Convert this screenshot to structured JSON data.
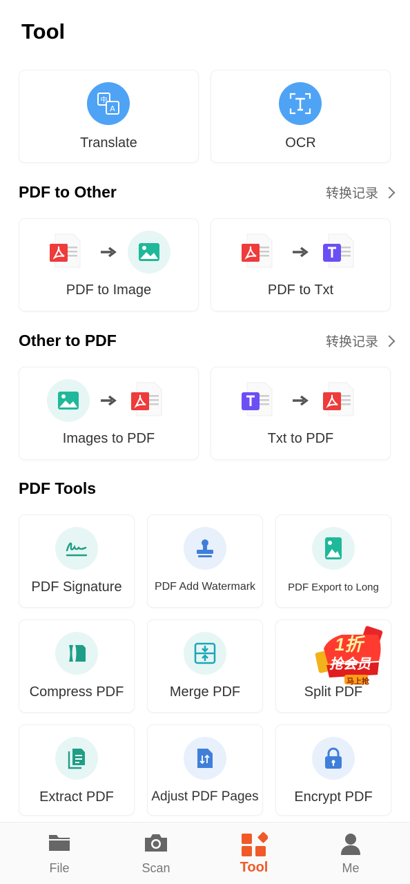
{
  "page": {
    "title": "Tool"
  },
  "top_tools": [
    {
      "label": "Translate",
      "icon": "translate-icon"
    },
    {
      "label": "OCR",
      "icon": "ocr-icon"
    }
  ],
  "pdf_to_other": {
    "title": "PDF to Other",
    "history": "转换记录",
    "items": [
      {
        "label": "PDF to Image"
      },
      {
        "label": "PDF to Txt"
      }
    ]
  },
  "other_to_pdf": {
    "title": "Other to PDF",
    "history": "转换记录",
    "items": [
      {
        "label": "Images to PDF"
      },
      {
        "label": "Txt to PDF"
      }
    ]
  },
  "pdf_tools": {
    "title": "PDF Tools",
    "items": [
      {
        "label": "PDF Signature",
        "icon": "signature-icon"
      },
      {
        "label": "PDF Add Watermark",
        "icon": "stamp-icon"
      },
      {
        "label": "PDF Export to Long",
        "icon": "long-image-icon"
      },
      {
        "label": "Compress PDF",
        "icon": "compress-icon"
      },
      {
        "label": "Merge PDF",
        "icon": "merge-icon"
      },
      {
        "label": "Split PDF",
        "icon": "split-icon"
      },
      {
        "label": "Extract PDF",
        "icon": "extract-icon"
      },
      {
        "label": "Adjust PDF Pages",
        "icon": "adjust-pages-icon"
      },
      {
        "label": "Encrypt PDF",
        "icon": "lock-icon"
      }
    ]
  },
  "promo": {
    "line1": "1折",
    "line2": "抢会员",
    "line3": "马上抢"
  },
  "tabbar": {
    "tabs": [
      {
        "label": "File",
        "icon": "folder-icon"
      },
      {
        "label": "Scan",
        "icon": "camera-icon"
      },
      {
        "label": "Tool",
        "icon": "tool-grid-icon",
        "active": true
      },
      {
        "label": "Me",
        "icon": "person-icon"
      }
    ]
  },
  "colors": {
    "accent": "#f05a28",
    "blue": "#4ea3f5",
    "pdf_red": "#ee3b3b",
    "txt_purple": "#6c4ef5",
    "image_teal": "#1fb89a",
    "light_circle": "#e6f6f4"
  }
}
